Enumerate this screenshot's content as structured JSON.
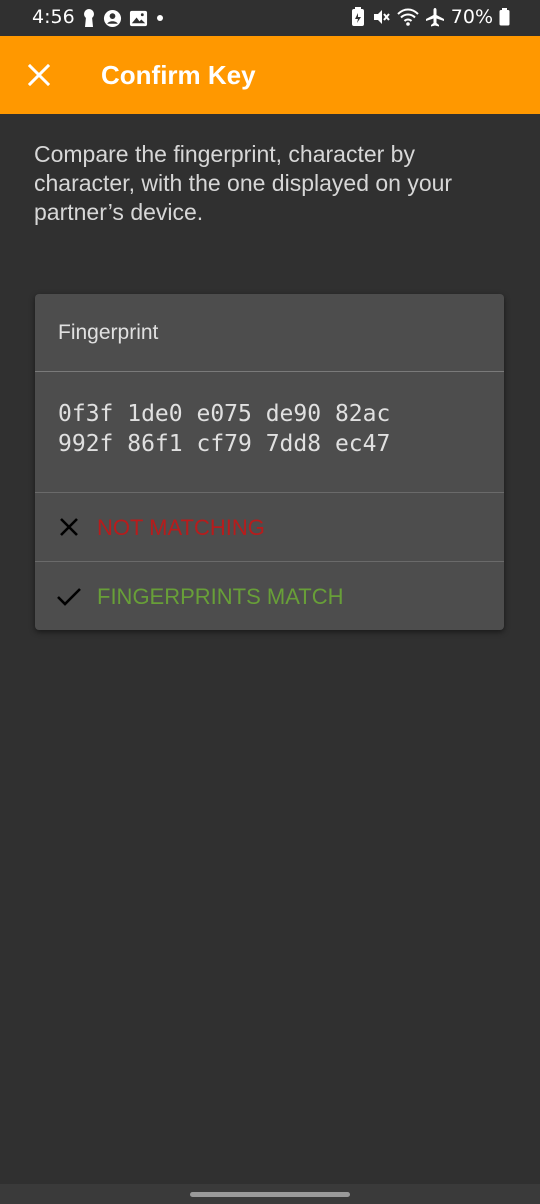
{
  "status_bar": {
    "time": "4:56",
    "battery": "70%",
    "left_icons": [
      "keyhole-icon",
      "account-circle-icon",
      "image-icon",
      "dot-icon"
    ],
    "right_icons": [
      "battery-saver-icon",
      "mute-icon",
      "wifi-icon",
      "airplane-icon",
      "battery-icon"
    ]
  },
  "app_bar": {
    "title": "Confirm Key",
    "close_icon": "close-icon",
    "color": "#ff9800"
  },
  "instructions": "Compare the fingerprint, character by character, with the one displayed on your partner’s device.",
  "card": {
    "title": "Fingerprint",
    "fingerprint_line1": "0f3f 1de0 e075 de90 82ac",
    "fingerprint_line2": "992f 86f1 cf79 7dd8 ec47",
    "options": {
      "not_matching": {
        "label": "NOT MATCHING",
        "icon": "x-icon",
        "color": "#b71c1c"
      },
      "match": {
        "label": "FINGERPRINTS MATCH",
        "icon": "check-icon",
        "color": "#689f38"
      }
    }
  }
}
